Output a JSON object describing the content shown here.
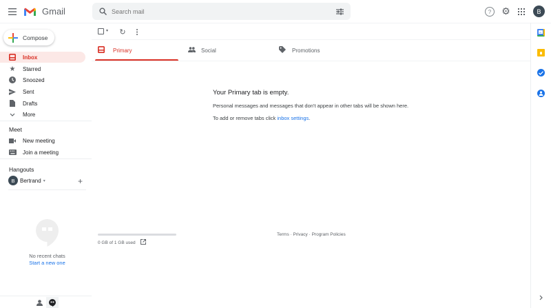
{
  "header": {
    "app_name": "Gmail",
    "search_placeholder": "Search mail",
    "avatar_letter": "B"
  },
  "compose_label": "Compose",
  "nav": [
    {
      "label": "Inbox",
      "icon": "inbox-icon"
    },
    {
      "label": "Starred",
      "icon": "star-icon"
    },
    {
      "label": "Snoozed",
      "icon": "clock-icon"
    },
    {
      "label": "Sent",
      "icon": "send-icon"
    },
    {
      "label": "Drafts",
      "icon": "draft-icon"
    },
    {
      "label": "More",
      "icon": "chevron-down-icon"
    }
  ],
  "meet": {
    "title": "Meet",
    "new_meeting": "New meeting",
    "join_meeting": "Join a meeting"
  },
  "hangouts": {
    "title": "Hangouts",
    "user": "Bertrand",
    "user_initial": "B",
    "no_chats": "No recent chats",
    "start_new": "Start a new one"
  },
  "tabs": [
    {
      "label": "Primary"
    },
    {
      "label": "Social"
    },
    {
      "label": "Promotions"
    }
  ],
  "empty": {
    "title": "Your Primary tab is empty.",
    "line1": "Personal messages and messages that don't appear in other tabs will be shown here.",
    "line2_prefix": "To add or remove tabs click ",
    "line2_link": "inbox settings",
    "line2_suffix": "."
  },
  "footer": {
    "storage": "0 GB of 1 GB used",
    "storage_fraction": 0,
    "terms": "Terms",
    "privacy": "Privacy",
    "policies": "Program Policies",
    "dot": " · "
  },
  "colors": {
    "accent": "#d93025",
    "link": "#1a73e8"
  }
}
